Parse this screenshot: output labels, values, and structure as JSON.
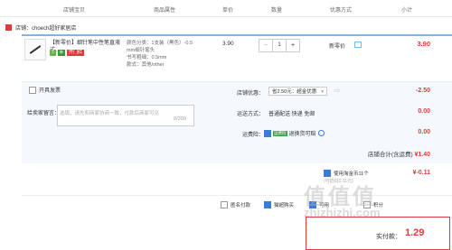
{
  "header": {
    "columns": [
      "店铺宝贝",
      "商品属性",
      "单价",
      "数量",
      "优惠方式",
      "小计"
    ]
  },
  "store": {
    "label": "店铺：choech超好家居店"
  },
  "item": {
    "title": "【新零价】细针笔中性笔直液式…",
    "badges": [
      "7",
      "⊕",
      "开门红"
    ],
    "attrs": [
      "颜色分类：1支装（黑色）-0.5",
      "mm细针笔头",
      "书写粗细：0.5mm",
      "款式：其他/other"
    ],
    "price": "3.90",
    "quantity": "1",
    "minus": "−",
    "plus": "+",
    "promo": "新零价",
    "subtotal": "3.90"
  },
  "options": {
    "invoice": "开具发票",
    "note_label": "给卖家留言：",
    "note_placeholder": "选填，请先和商家协商一致，付款后商家可见",
    "note_count": "0/200",
    "store_promo_label": "店铺优惠：",
    "store_promo_select": "省2.50元：超金优惠",
    "store_promo_val": "-2.50",
    "shipping_label": "运送方式：",
    "shipping_text": "普通配送 快递 免邮",
    "shipping_val": "0.00",
    "freight_label": "运费险：",
    "freight_tag": "运费险",
    "freight_text": "退换货可赔",
    "freight_val": "0.00",
    "store_total_label": "店铺合计(含运费)",
    "store_total_val": "¥1.40"
  },
  "coupon": {
    "label": "使用淘金币11个",
    "val": "¥-0.11",
    "sub": "(可抵扣0.11元)"
  },
  "bottom": {
    "anon": "匿名付款",
    "tmall": "猫超购买",
    "other1": "可用",
    "other2": "积分",
    "pay_label": "实付款：",
    "pay_val": "1.29"
  },
  "watermark": {
    "cn": "值值值",
    "en": "zhizhizhi.com"
  },
  "colors": {
    "accent": "#e4393c",
    "blue": "#7cb5ec",
    "green": "#3ea04b"
  }
}
